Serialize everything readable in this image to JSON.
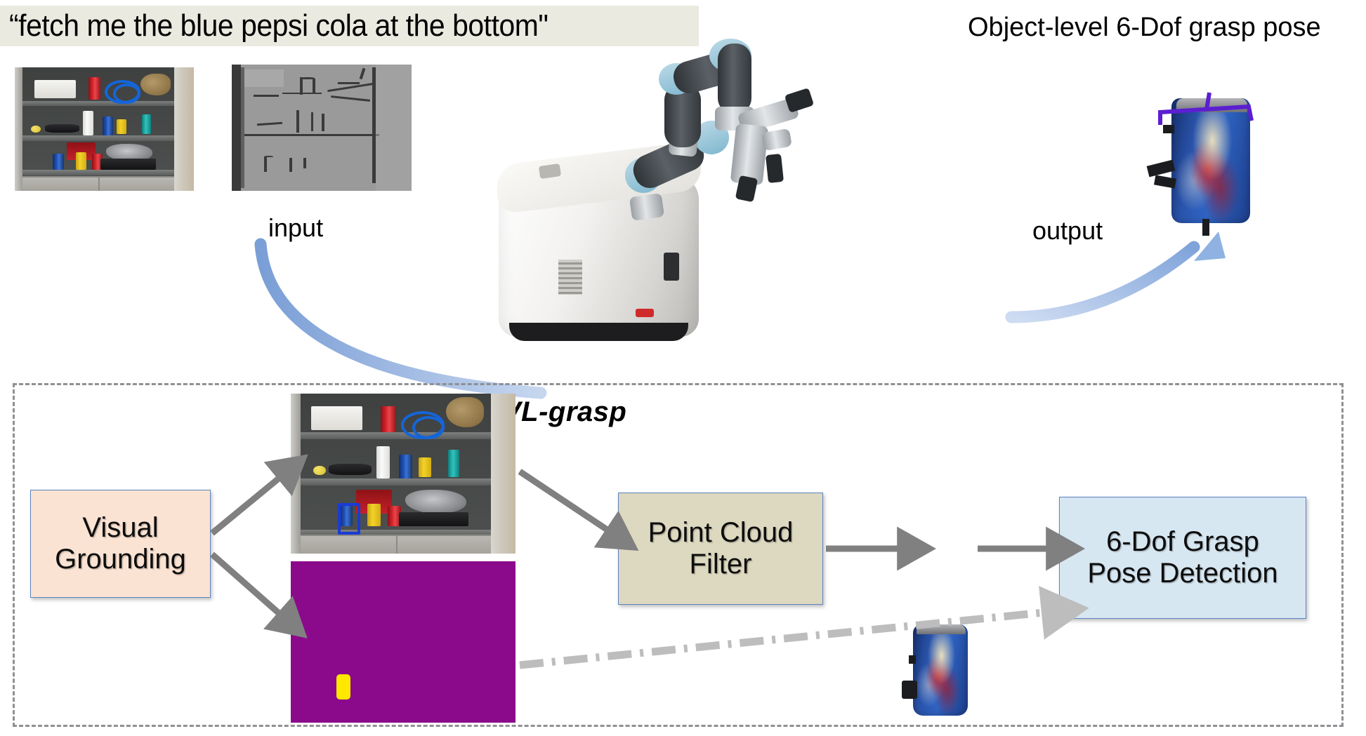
{
  "instruction": {
    "text": "“fetch me the blue pepsi cola at the bottom\"",
    "background_color": "#ebeae0"
  },
  "captions": {
    "output_title": "Object-level 6-Dof grasp pose",
    "input_label": "input",
    "output_label": "output"
  },
  "framework": {
    "title": "VL-grasp",
    "border_style": "dashed",
    "border_color": "#8e9094"
  },
  "blocks": [
    {
      "id": "visual-grounding",
      "label_line1": "Visual",
      "label_line2": "Grounding",
      "fill": "#fbe3d3",
      "border": "#5a83c2"
    },
    {
      "id": "point-cloud-filter",
      "label_line1": "Point Cloud",
      "label_line2": "Filter",
      "fill": "#ddd9c0",
      "border": "#5a83c2"
    },
    {
      "id": "grasp-detection",
      "label_line1": "6-Dof Grasp",
      "label_line2": "Pose Detection",
      "fill": "#d7e7f2",
      "border": "#5a83c2"
    }
  ],
  "images": {
    "rgb_scene": {
      "name": "shelf-rgb-photo",
      "description": "cabinet shelf with cans, cups, bottle, lemon, bagged object, blue cable"
    },
    "depth_scene": {
      "name": "shelf-depth-map",
      "description": "gray depth image of the same shelf"
    },
    "robot": {
      "name": "mobile-manipulator-robot",
      "description": "white mobile base with UR robot arm and gripper"
    },
    "grasp_pointcloud": {
      "name": "grasp-pose-pointcloud",
      "description": "colored point cloud of pepsi can with purple gripper pose"
    },
    "grounded_scene": {
      "name": "grounded-shelf-photo",
      "description": "shelf photo with blue bounding box on the target pepsi can"
    },
    "mask": {
      "name": "segmentation-mask",
      "description": "purple mask image with yellow target region",
      "background_color": "#8b0a8b",
      "target_color": "#ffe800"
    },
    "filtered_pointcloud": {
      "name": "filtered-object-pointcloud",
      "description": "cropped colored point cloud of the pepsi can"
    }
  },
  "arrows": [
    {
      "id": "input-arrow",
      "color": "#8fadd9",
      "style": "curved",
      "label": "input"
    },
    {
      "id": "output-arrow",
      "color": "#8fadd9",
      "style": "curved",
      "label": "output"
    },
    {
      "id": "grounding-to-rgb",
      "color": "#808080",
      "style": "solid"
    },
    {
      "id": "grounding-to-mask",
      "color": "#808080",
      "style": "solid"
    },
    {
      "id": "rgb-to-filter",
      "color": "#808080",
      "style": "solid"
    },
    {
      "id": "filter-to-pointcloud",
      "color": "#808080",
      "style": "solid"
    },
    {
      "id": "pointcloud-to-detection",
      "color": "#808080",
      "style": "solid"
    },
    {
      "id": "mask-to-detection",
      "color": "#bdbdbd",
      "style": "dash-dot"
    }
  ]
}
